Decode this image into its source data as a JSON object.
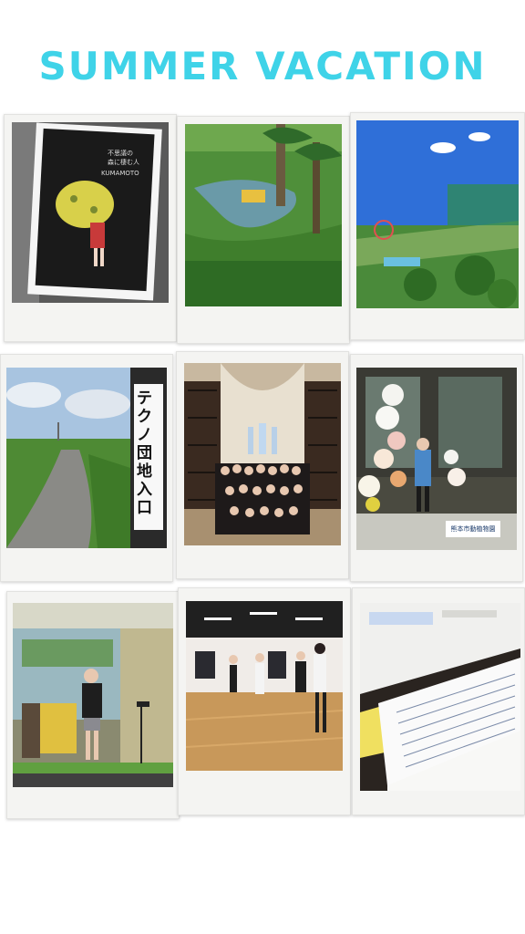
{
  "title": "SUMMER VACATION",
  "photos": [
    {
      "id": "poster",
      "subject": "exhibition poster",
      "lines": [
        "不思議の",
        "森に棲む人",
        "KUMAMOTO"
      ]
    },
    {
      "id": "water-ride",
      "subject": "water ride in park"
    },
    {
      "id": "amusement-view",
      "subject": "amusement park view"
    },
    {
      "id": "country-path",
      "subject": "country path"
    },
    {
      "id": "techno-sign",
      "subject": "station sign",
      "sign": "テクノ団地入口"
    },
    {
      "id": "chapel-group",
      "subject": "group photo in chapel"
    },
    {
      "id": "flower-garden",
      "subject": "girl at flower display",
      "sign": "熊本市動植物園"
    },
    {
      "id": "stage-performance",
      "subject": "singing on stage"
    },
    {
      "id": "dance-studio",
      "subject": "dance practice"
    },
    {
      "id": "study-notebook",
      "subject": "textbook and notebook"
    }
  ]
}
